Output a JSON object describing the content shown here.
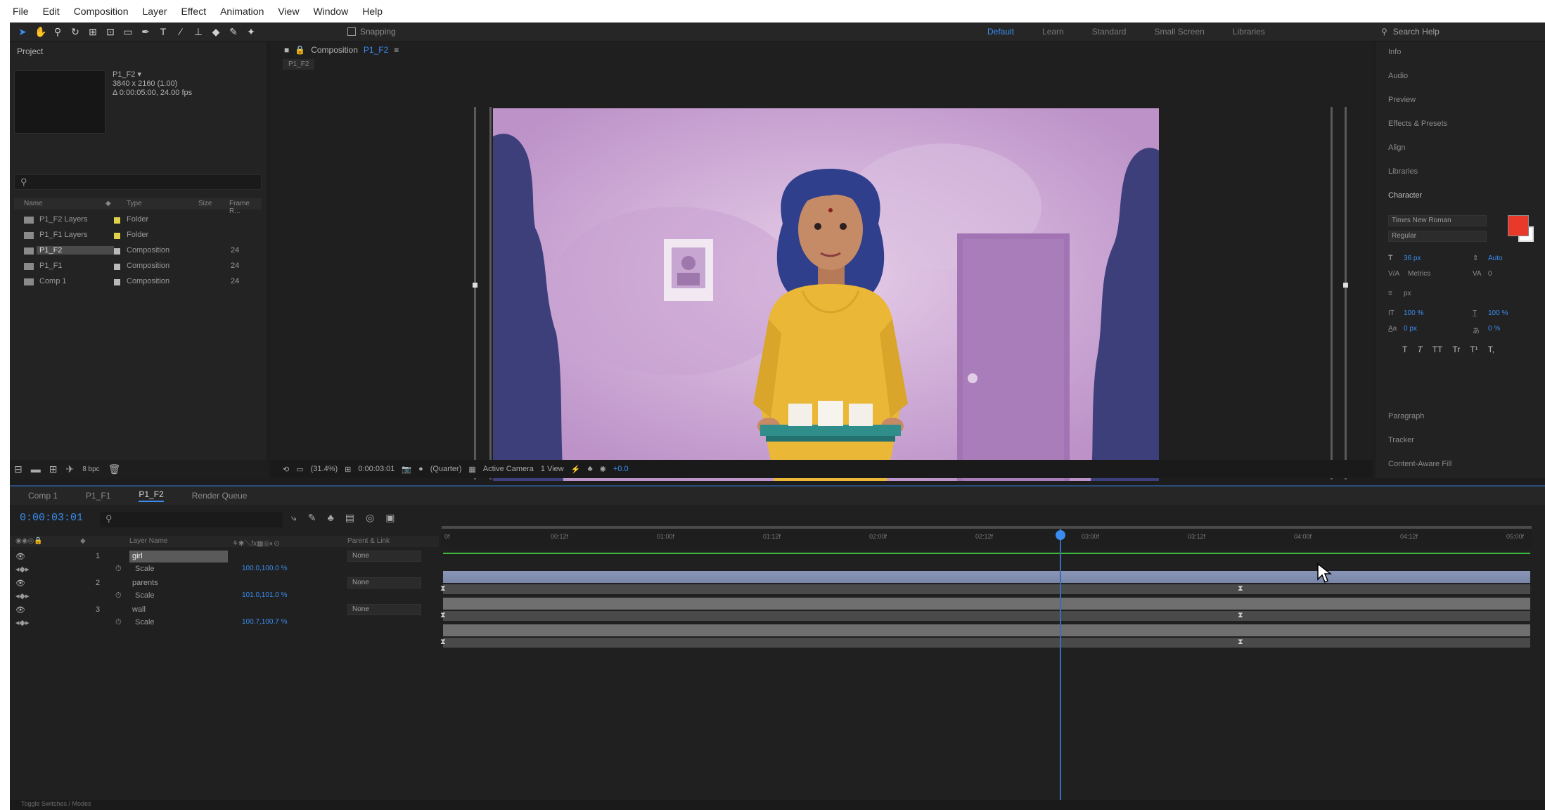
{
  "menu": [
    "File",
    "Edit",
    "Composition",
    "Layer",
    "Effect",
    "Animation",
    "View",
    "Window",
    "Help"
  ],
  "toolbar": {
    "snapping_label": "Snapping",
    "workspaces": [
      "Default",
      "Learn",
      "Standard",
      "Small Screen",
      "Libraries"
    ],
    "active_workspace": "Default",
    "search_help_placeholder": "Search Help"
  },
  "project": {
    "title": "Project",
    "comp_name": "P1_F2 ▾",
    "comp_size": "3840 x 2160 (1.00)",
    "comp_duration": "Δ 0:00:05:00, 24.00 fps",
    "columns": {
      "name": "Name",
      "type": "Type",
      "size": "Size",
      "frame_rate": "Frame R..."
    },
    "items": [
      {
        "name": "P1_F2 Layers",
        "type": "Folder",
        "fps": "",
        "label": "#e0d24a"
      },
      {
        "name": "P1_F1 Layers",
        "type": "Folder",
        "fps": "",
        "label": "#e0d24a"
      },
      {
        "name": "P1_F2",
        "type": "Composition",
        "fps": "24",
        "label": "#b9b9b9"
      },
      {
        "name": "P1_F1",
        "type": "Composition",
        "fps": "24",
        "label": "#b9b9b9"
      },
      {
        "name": "Comp 1",
        "type": "Composition",
        "fps": "24",
        "label": "#b9b9b9"
      }
    ],
    "selected_index": 2,
    "bpc": "8 bpc"
  },
  "composition": {
    "tab_prefix": "Composition",
    "tab_name": "P1_F2",
    "sub_tab": "P1_F2",
    "zoom": "(31.4%)",
    "time": "0:00:03:01",
    "resolution": "(Quarter)",
    "camera": "Active Camera",
    "views": "1 View",
    "exposure": "+0.0"
  },
  "right_panels": {
    "items": [
      "Info",
      "Audio",
      "Preview",
      "Effects & Presets",
      "Align",
      "Libraries"
    ],
    "character_title": "Character",
    "font_family": "Times New Roman",
    "font_style": "Regular",
    "font_size": "36 px",
    "leading": "Auto",
    "kerning": "Metrics",
    "tracking": "0",
    "stroke_width": "px",
    "vert_scale": "100 %",
    "horiz_scale": "100 %",
    "baseline": "0 px",
    "tsume": "0 %",
    "style_buttons": [
      "T",
      "T",
      "TT",
      "Tr",
      "T¹",
      "T,"
    ],
    "fill_color": "#e8392a",
    "after_items": [
      "Paragraph",
      "Tracker",
      "Content-Aware Fill"
    ]
  },
  "timeline": {
    "tabs": [
      "Comp 1",
      "P1_F1",
      "P1_F2",
      "Render Queue"
    ],
    "active_tab": "P1_F2",
    "current_time": "0:00:03:01",
    "columns": {
      "layer_name": "Layer Name",
      "parent": "Parent & Link"
    },
    "layers": [
      {
        "num": "1",
        "name": "girl",
        "parent": "None",
        "prop": "Scale",
        "value": "100.0,100.0 %"
      },
      {
        "num": "2",
        "name": "parents",
        "parent": "None",
        "prop": "Scale",
        "value": "101.0,101.0 %"
      },
      {
        "num": "3",
        "name": "wall",
        "parent": "None",
        "prop": "Scale",
        "value": "100.7,100.7 %"
      }
    ],
    "ruler_labels": [
      "0f",
      "00:12f",
      "01:00f",
      "01:12f",
      "02:00f",
      "02:12f",
      "03:00f",
      "03:12f",
      "04:00f",
      "04:12f",
      "05:00f"
    ],
    "footer": "Toggle Switches / Modes"
  }
}
